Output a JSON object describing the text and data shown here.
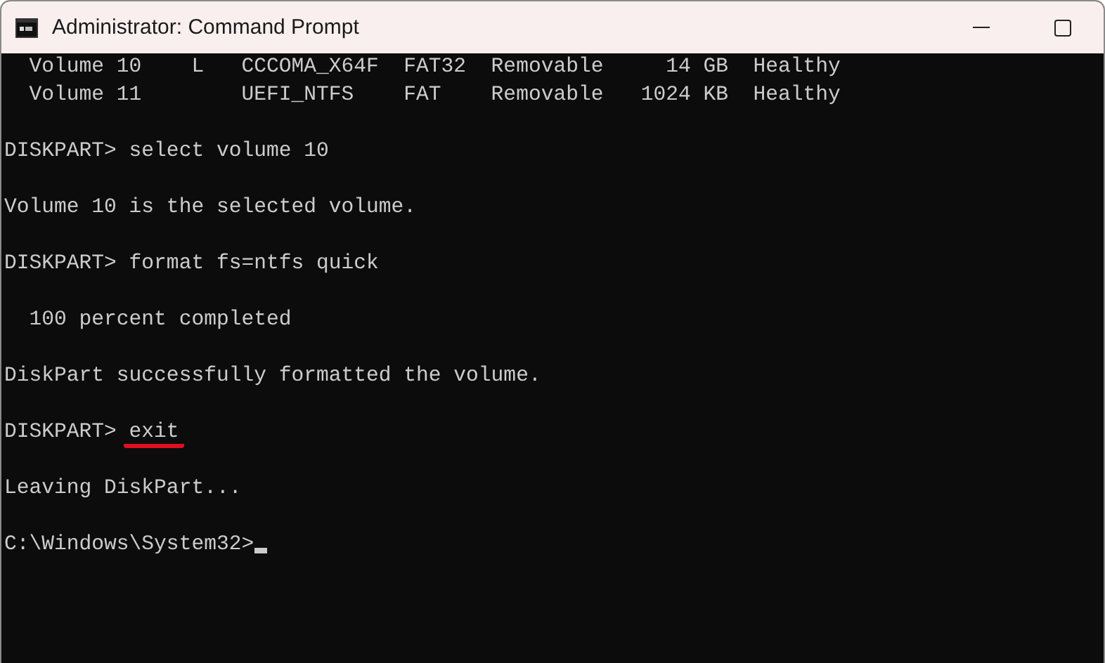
{
  "window": {
    "title": "Administrator: Command Prompt"
  },
  "console": {
    "lines": [
      {
        "kind": "output",
        "text": "  Volume 10    L   CCCOMA_X64F  FAT32  Removable     14 GB  Healthy"
      },
      {
        "kind": "output",
        "text": "  Volume 11        UEFI_NTFS    FAT    Removable   1024 KB  Healthy"
      },
      {
        "kind": "blank"
      },
      {
        "kind": "command",
        "prompt": "DISKPART>",
        "command": "select volume 10",
        "underlined": false
      },
      {
        "kind": "blank"
      },
      {
        "kind": "output",
        "text": "Volume 10 is the selected volume."
      },
      {
        "kind": "blank"
      },
      {
        "kind": "command",
        "prompt": "DISKPART>",
        "command": "format fs=ntfs quick",
        "underlined": false
      },
      {
        "kind": "blank"
      },
      {
        "kind": "output",
        "text": "  100 percent completed"
      },
      {
        "kind": "blank"
      },
      {
        "kind": "output",
        "text": "DiskPart successfully formatted the volume."
      },
      {
        "kind": "blank"
      },
      {
        "kind": "command",
        "prompt": "DISKPART>",
        "command": "exit",
        "underlined": true
      },
      {
        "kind": "blank"
      },
      {
        "kind": "output",
        "text": "Leaving DiskPart..."
      },
      {
        "kind": "blank"
      },
      {
        "kind": "prompt",
        "prompt": "C:\\Windows\\System32>",
        "cursor": true
      }
    ]
  }
}
